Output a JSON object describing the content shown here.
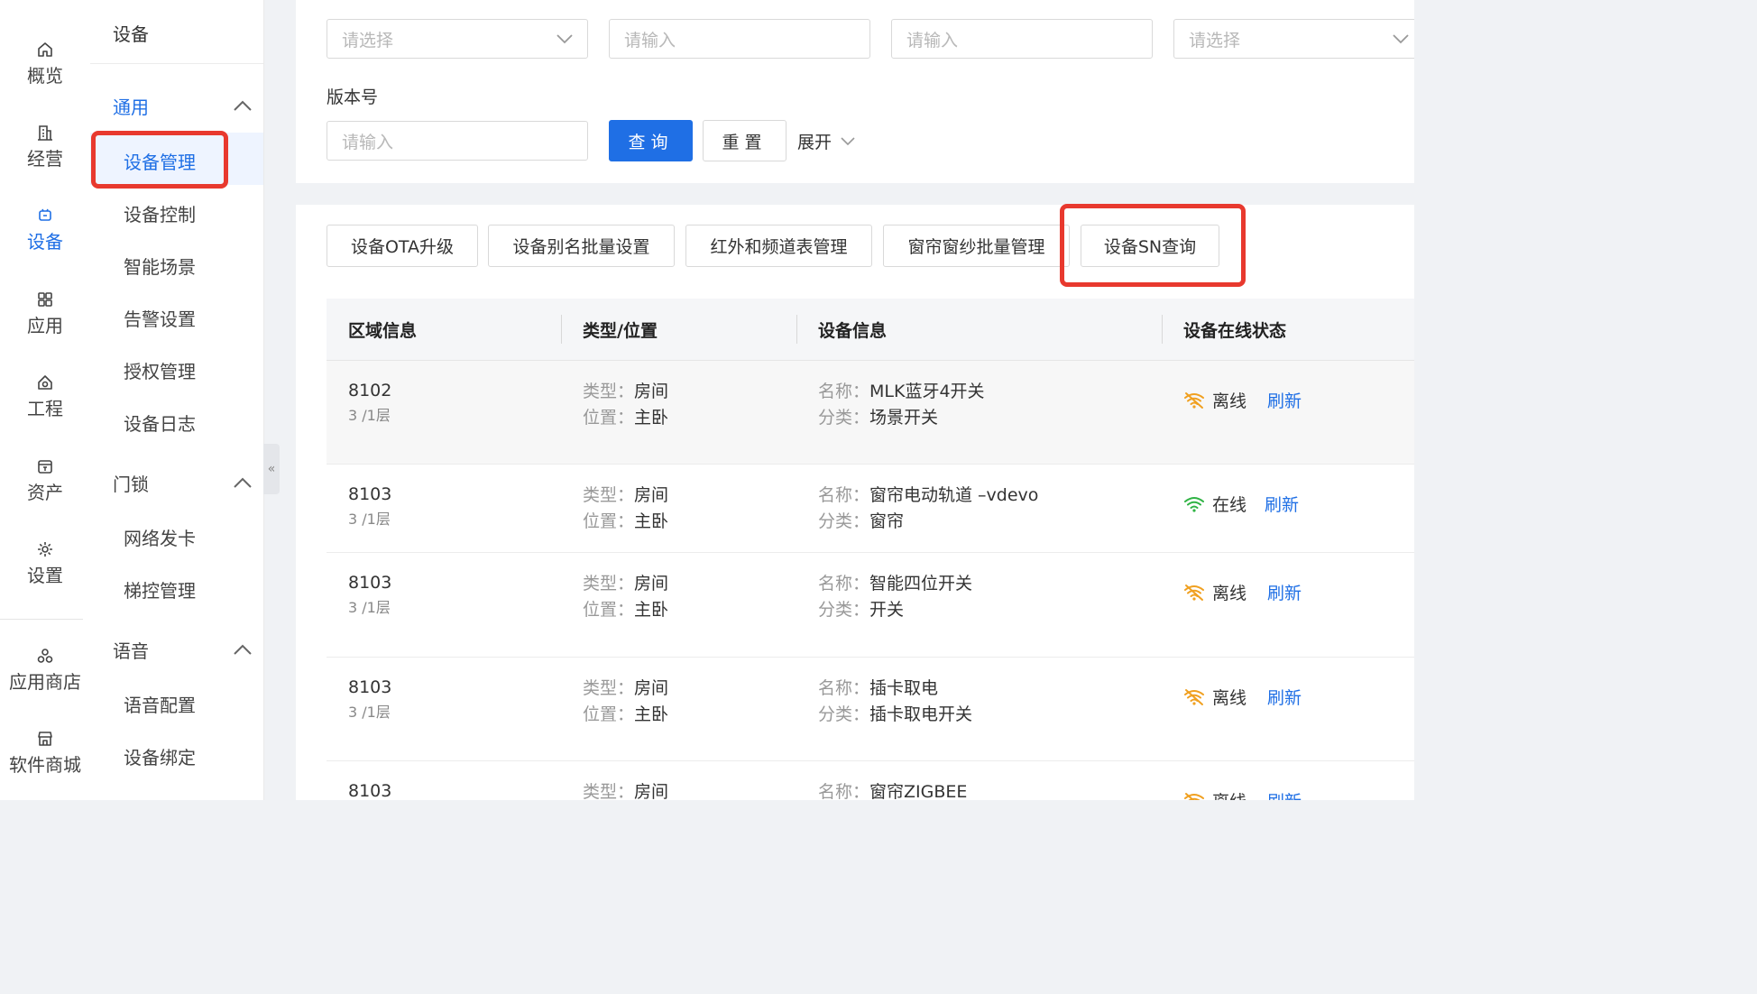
{
  "rail": {
    "items": [
      {
        "label": "概览",
        "icon": "home-icon"
      },
      {
        "label": "经营",
        "icon": "building-icon"
      },
      {
        "label": "设备",
        "icon": "device-icon",
        "active": true
      },
      {
        "label": "应用",
        "icon": "grid-icon"
      },
      {
        "label": "工程",
        "icon": "engineering-icon"
      },
      {
        "label": "资产",
        "icon": "asset-icon"
      },
      {
        "label": "设置",
        "icon": "gear-icon"
      },
      {
        "label": "应用商店",
        "icon": "app-store-icon"
      },
      {
        "label": "软件商城",
        "icon": "shop-icon"
      }
    ]
  },
  "submenu": {
    "title": "设备",
    "groups": [
      {
        "label": "通用",
        "items": [
          "设备管理",
          "设备控制",
          "智能场景",
          "告警设置",
          "授权管理",
          "设备日志"
        ]
      },
      {
        "label": "门锁",
        "items": [
          "网络发卡",
          "梯控管理"
        ]
      },
      {
        "label": "语音",
        "items": [
          "语音配置",
          "设备绑定"
        ]
      }
    ],
    "active_item": "设备管理"
  },
  "search": {
    "fields": [
      {
        "placeholder": "请选择",
        "type": "select"
      },
      {
        "placeholder": "请输入",
        "type": "input"
      },
      {
        "placeholder": "请输入",
        "type": "input"
      },
      {
        "placeholder": "请选择",
        "type": "select"
      }
    ],
    "version_label": "版本号",
    "version_placeholder": "请输入",
    "query_label": "查询",
    "reset_label": "重置",
    "expand_label": "展开"
  },
  "toolbar": {
    "buttons": [
      "设备OTA升级",
      "设备别名批量设置",
      "红外和频道表管理",
      "窗帘窗纱批量管理",
      "设备SN查询"
    ]
  },
  "table": {
    "headers": [
      "区域信息",
      "类型/位置",
      "设备信息",
      "设备在线状态"
    ],
    "type_key": "类型：",
    "position_key": "位置：",
    "name_key": "名称：",
    "category_key": "分类：",
    "refresh_label": "刷新",
    "rows": [
      {
        "area": "8102",
        "floor": "3 /1层",
        "type": "房间",
        "position": "主卧",
        "name": "MLK蓝牙4开关",
        "category": "场景开关",
        "status": "离线",
        "online": false
      },
      {
        "area": "8103",
        "floor": "3 /1层",
        "type": "房间",
        "position": "主卧",
        "name": "窗帘电动轨道 –vdevo",
        "category": "窗帘",
        "status": "在线",
        "online": true
      },
      {
        "area": "8103",
        "floor": "3 /1层",
        "type": "房间",
        "position": "主卧",
        "name": "智能四位开关",
        "category": "开关",
        "status": "离线",
        "online": false
      },
      {
        "area": "8103",
        "floor": "3 /1层",
        "type": "房间",
        "position": "主卧",
        "name": "插卡取电",
        "category": "插卡取电开关",
        "status": "离线",
        "online": false
      },
      {
        "area": "8103",
        "floor": "",
        "type": "房间",
        "position": "",
        "name": "窗帘ZIGBEE",
        "category": "",
        "status": "离线",
        "online": false
      }
    ]
  },
  "colors": {
    "accent": "#1f6fe5",
    "highlight": "#e8392e",
    "online": "#2fb344",
    "offline": "#f0a020"
  }
}
